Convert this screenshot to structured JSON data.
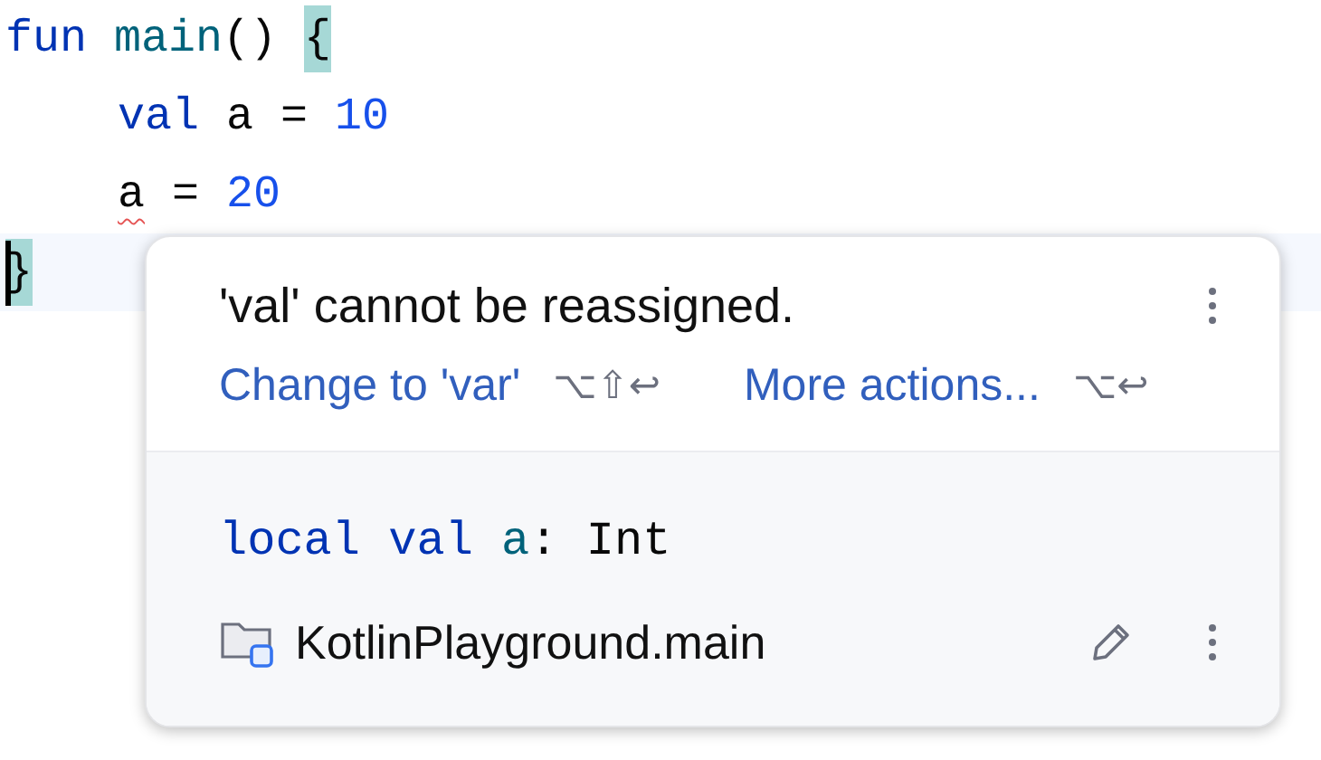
{
  "code": {
    "lines": [
      {
        "current": false,
        "tokens": [
          {
            "text": "fun ",
            "kind": "keyword",
            "highlighted": false,
            "error": false
          },
          {
            "text": "main",
            "kind": "function",
            "highlighted": false,
            "error": false
          },
          {
            "text": "() ",
            "kind": "plain",
            "highlighted": false,
            "error": false
          },
          {
            "text": "{",
            "kind": "plain",
            "highlighted": true,
            "error": false
          }
        ],
        "children": [
          {
            "current": false,
            "tokens": [
              {
                "text": "val",
                "kind": "keyword",
                "highlighted": false,
                "error": false
              },
              {
                "text": " a = ",
                "kind": "plain",
                "highlighted": false,
                "error": false
              },
              {
                "text": "10",
                "kind": "number",
                "highlighted": false,
                "error": false
              }
            ]
          },
          {
            "current": false,
            "tokens": [
              {
                "text": "a",
                "kind": "plain",
                "highlighted": false,
                "error": true
              },
              {
                "text": " = ",
                "kind": "plain",
                "highlighted": false,
                "error": false
              },
              {
                "text": "20",
                "kind": "number",
                "highlighted": false,
                "error": false
              }
            ]
          }
        ]
      },
      {
        "current": true,
        "tokens": [
          {
            "text": "}",
            "kind": "plain",
            "highlighted": true,
            "error": false
          }
        ]
      }
    ]
  },
  "popup": {
    "message": "'val' cannot be reassigned.",
    "actions": [
      {
        "label": "Change to 'var'",
        "shortcut": "⌥⇧↩"
      },
      {
        "label": "More actions...",
        "shortcut": "⌥↩"
      }
    ],
    "signature": [
      {
        "text": "local ",
        "kind": "keyword"
      },
      {
        "text": "val ",
        "kind": "keyword"
      },
      {
        "text": "a",
        "kind": "variable"
      },
      {
        "text": ": Int",
        "kind": "plain"
      }
    ],
    "location": "KotlinPlayground.main"
  }
}
